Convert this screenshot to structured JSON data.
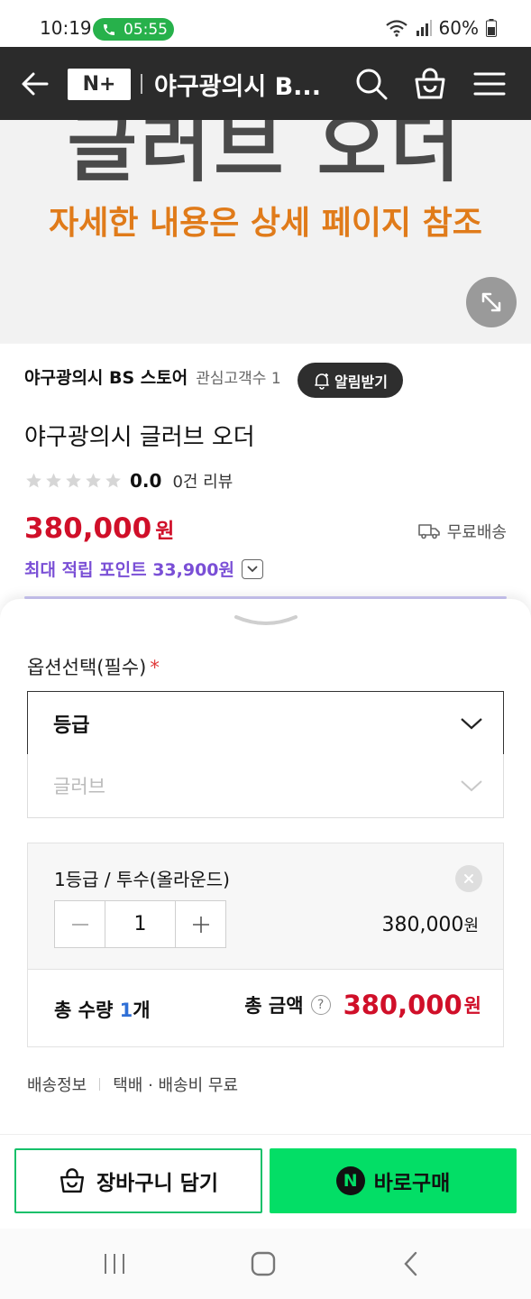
{
  "status_bar": {
    "time": "10:19",
    "call_timer": "05:55",
    "battery": "60%"
  },
  "top_nav": {
    "logo_text": "N+",
    "store_title": "야구광의시 B..."
  },
  "banner": {
    "headline": "글러브 오더",
    "subline": "자세한 내용은 상세 페이지 참조"
  },
  "store": {
    "name": "야구광의시 BS 스토어",
    "followers": "관심고객수 1",
    "alert_label": "알림받기"
  },
  "product": {
    "title": "야구광의시 글러브 오더",
    "rating": "0.0",
    "reviews": "0건 리뷰",
    "price": "380,000",
    "currency": "원",
    "shipping": "무료배송",
    "points": "최대 적립 포인트 33,900원"
  },
  "options": {
    "label": "옵션선택(필수)",
    "required_mark": "*",
    "select_grade": "등급",
    "select_glove": "글러브"
  },
  "selected_item": {
    "name": "1등급 / 투수(올라운드)",
    "quantity": "1",
    "price": "380,000",
    "currency": "원"
  },
  "totals": {
    "qty_prefix": "총 수량 ",
    "qty_value": "1",
    "qty_suffix": "개",
    "amount_label": "총 금액",
    "help": "?",
    "amount": "380,000",
    "currency": "원"
  },
  "delivery": {
    "label": "배송정보",
    "value": "택배 · 배송비 무료"
  },
  "actions": {
    "cart_label": "장바구니 담기",
    "buy_label": "바로구매",
    "npay_mark": "N"
  },
  "colors": {
    "nav_bg": "#2b2b2b",
    "price_red": "#d00f29",
    "points_purple": "#7a4fd6",
    "naver_green": "#03de66",
    "banner_orange": "#e07b1a"
  }
}
